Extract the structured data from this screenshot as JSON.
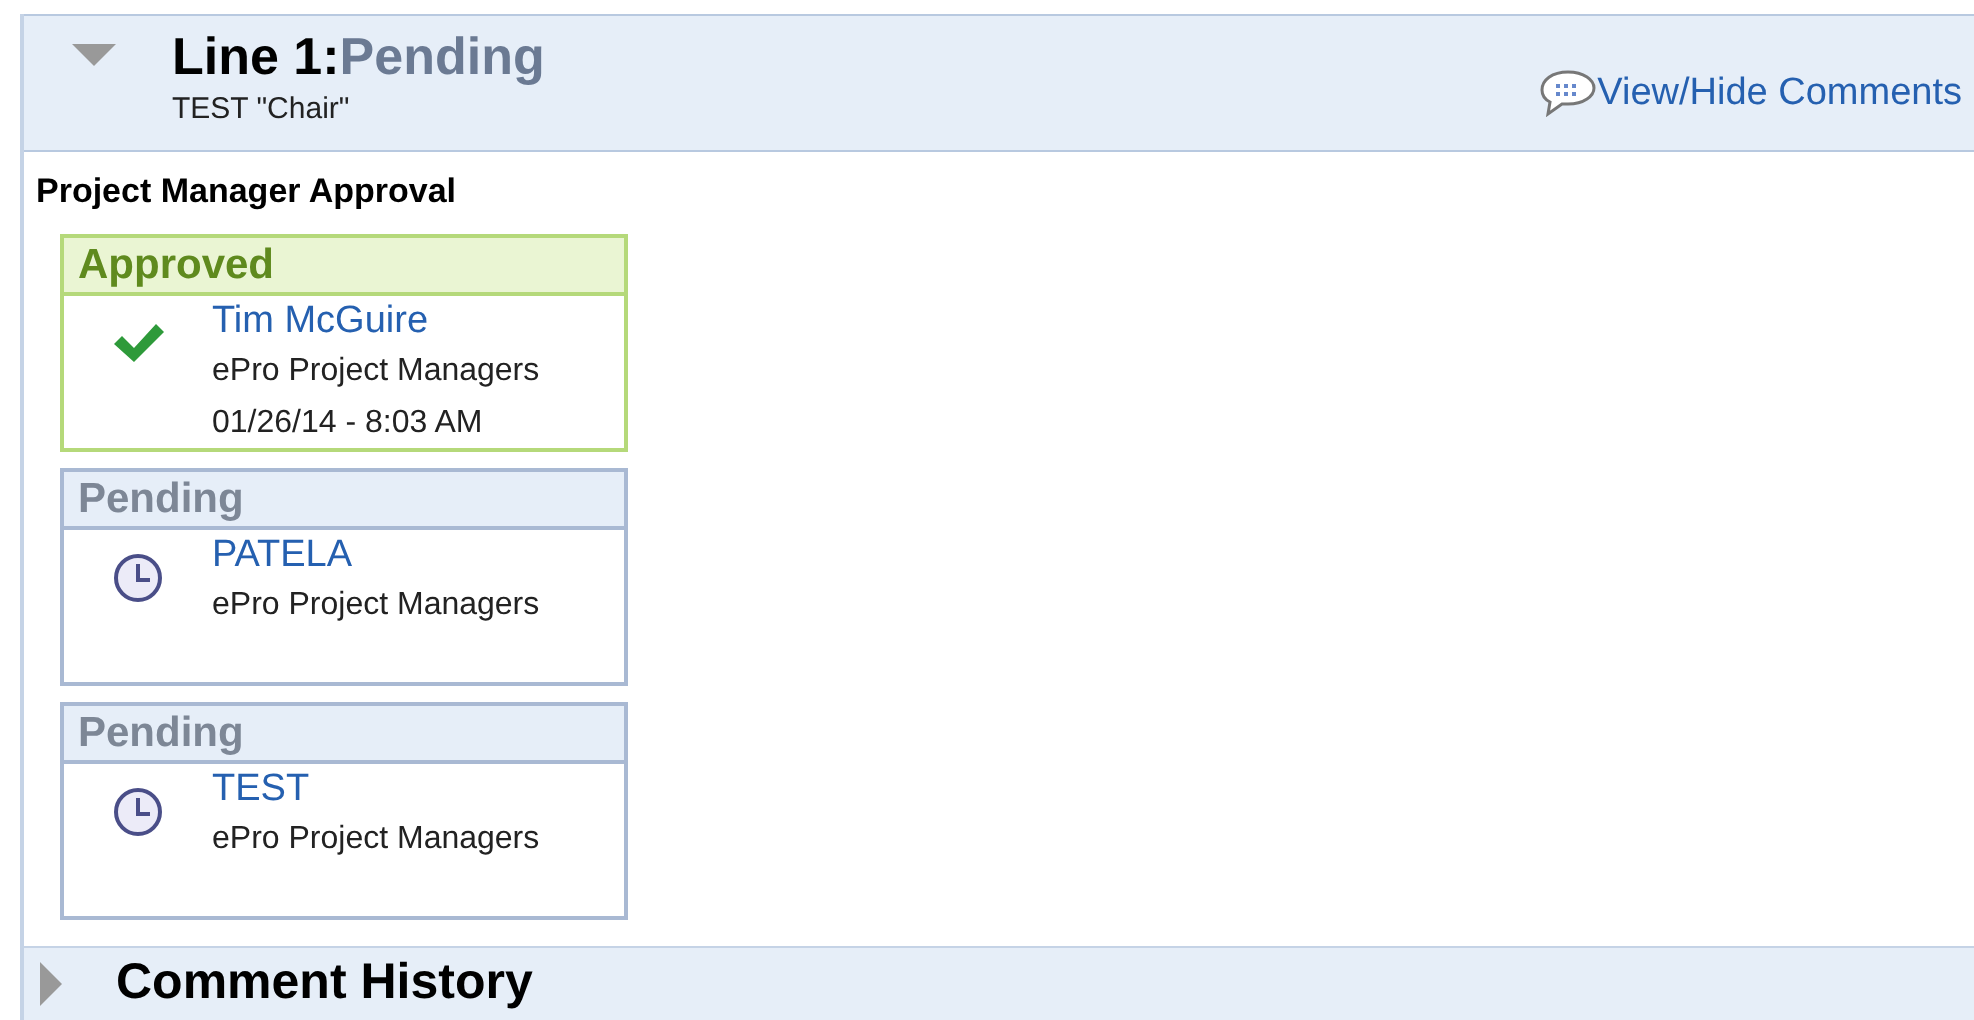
{
  "line": {
    "title": "Line 1:",
    "status": "Pending",
    "subtitle": "TEST \"Chair\"",
    "expanded": true,
    "link": "View/Hide Comments"
  },
  "stage": {
    "title": "Project Manager Approval"
  },
  "approvers": [
    {
      "kind": "approved",
      "status": "Approved",
      "name": "Tim McGuire",
      "group": "ePro Project Managers",
      "time": "01/26/14 - 8:03 AM"
    },
    {
      "kind": "pending",
      "status": "Pending",
      "name": "PATELA",
      "group": "ePro Project Managers"
    },
    {
      "kind": "pending",
      "status": "Pending",
      "name": "TEST",
      "group": "ePro Project Managers"
    }
  ],
  "comment_history": {
    "title": "Comment History",
    "expanded": false
  }
}
